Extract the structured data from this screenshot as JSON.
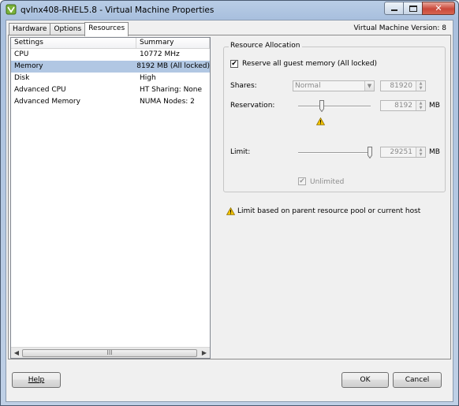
{
  "window": {
    "title": "qvlnx408-RHEL5.8 - Virtual Machine Properties",
    "close_symbol": "✕"
  },
  "tabs": [
    {
      "label": "Hardware",
      "active": false
    },
    {
      "label": "Options",
      "active": false
    },
    {
      "label": "Resources",
      "active": true
    }
  ],
  "vm_version": "Virtual Machine Version: 8",
  "settings_table": {
    "headers": [
      "Settings",
      "Summary"
    ],
    "rows": [
      {
        "setting": "CPU",
        "summary": "10772 MHz"
      },
      {
        "setting": "Memory",
        "summary": "8192 MB (All locked)"
      },
      {
        "setting": "Disk",
        "summary": "High"
      },
      {
        "setting": "Advanced CPU",
        "summary": "HT Sharing: None"
      },
      {
        "setting": "Advanced Memory",
        "summary": "NUMA Nodes: 2"
      }
    ],
    "selected_row": "Memory",
    "scroll_grip": "III"
  },
  "resource_allocation": {
    "legend": "Resource Allocation",
    "reserve_all": {
      "label": "Reserve all guest memory (All locked)",
      "checked": true
    },
    "shares": {
      "label": "Shares:",
      "level": "Normal",
      "value": "81920"
    },
    "reservation": {
      "label": "Reservation:",
      "value": "8192",
      "unit": "MB"
    },
    "limit": {
      "label": "Limit:",
      "value": "29251",
      "unit": "MB"
    },
    "unlimited": {
      "label": "Unlimited",
      "checked": true,
      "enabled": false
    }
  },
  "warning_note": "Limit based on parent resource pool or current host",
  "buttons": {
    "help": "Help",
    "ok": "OK",
    "cancel": "Cancel"
  },
  "colors": {
    "selection": "#b1c7e3",
    "warning": "#f2c200"
  }
}
